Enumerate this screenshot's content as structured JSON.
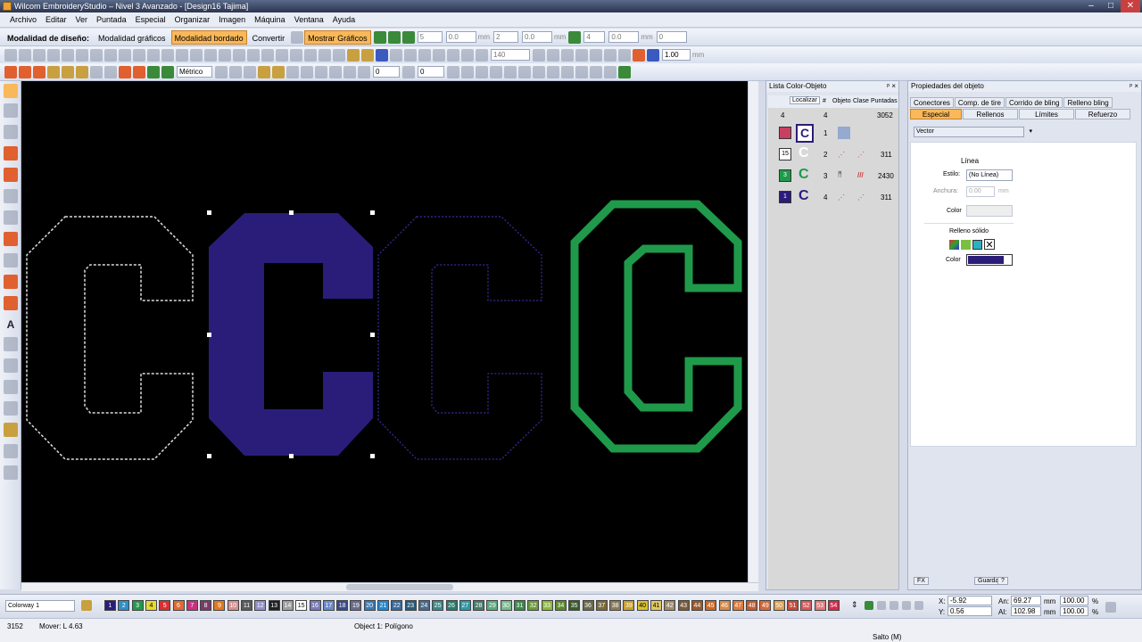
{
  "window": {
    "title": "Wilcom EmbroideryStudio – Nivel 3 Avanzado - [Design16       Tajima]",
    "controls": [
      "–",
      "□",
      "✕"
    ]
  },
  "menu": [
    "Archivo",
    "Editar",
    "Ver",
    "Puntada",
    "Especial",
    "Organizar",
    "Imagen",
    "Máquina",
    "Ventana",
    "Ayuda"
  ],
  "mode_toolbar": {
    "label": "Modalidad de diseño:",
    "graphics_mode": "Modalidad gráficos",
    "embroidery_mode": "Modalidad bordado",
    "convert": "Convertir",
    "show_graphics": "Mostrar Gráficos"
  },
  "transform_toolbar": {
    "fields": [
      "5",
      "0.0",
      "2",
      "0.0",
      "4",
      "0.0",
      "0"
    ],
    "units": [
      "mm",
      "mm",
      "mm",
      "mm"
    ]
  },
  "zoom_toolbar": {
    "zoom": "140",
    "scale": "1.00",
    "scale_unit": "mm"
  },
  "third_toolbar": {
    "units_select": "Métrico",
    "angle_a": "0",
    "angle_b": "0"
  },
  "color_list": {
    "title": "Lista Color-Objeto",
    "locate_button": "Localizar",
    "headers": [
      "#",
      "Objeto",
      "Clase",
      "Puntadas"
    ],
    "summary": {
      "colors": "4",
      "count": "4",
      "stitches": "3052"
    },
    "rows": [
      {
        "color_num": "1",
        "num": "1",
        "stitches": "",
        "swatch": "#c84060"
      },
      {
        "color_num": "15",
        "num": "2",
        "stitches": "311",
        "swatch": "#ffffff"
      },
      {
        "color_num": "3",
        "num": "3",
        "stitches": "2430",
        "swatch": "#1f9a4a"
      },
      {
        "color_num": "1",
        "num": "4",
        "stitches": "311",
        "swatch": "#2a1d7a"
      }
    ]
  },
  "properties": {
    "title": "Propiedades del objeto",
    "tabs_row1": [
      "Conectores",
      "Comp. de tire",
      "Corrido de bling",
      "Relleno bling"
    ],
    "tabs_row2": [
      "Especial",
      "Rellenos",
      "Límites",
      "Refuerzo"
    ],
    "active_tab": "Especial",
    "type_select": "Vector",
    "line_section": "Línea",
    "style_label": "Estilo:",
    "style_value": "(No Línea)",
    "width_label": "Anchura:",
    "width_value": "0.00",
    "width_unit": "mm",
    "line_color_label": "Color",
    "fill_section": "Relleno sólido",
    "fill_color_label": "Color",
    "fill_color": "#2a1d7a",
    "fx_button": "FX",
    "save_button": "Guardar",
    "help_button": "?"
  },
  "colorway": {
    "name": "Colorway 1",
    "swatches": [
      {
        "n": "1",
        "c": "#2a1d7a"
      },
      {
        "n": "2",
        "c": "#2f8fc8"
      },
      {
        "n": "3",
        "c": "#1f9a4a"
      },
      {
        "n": "4",
        "c": "#e8d830"
      },
      {
        "n": "5",
        "c": "#d83030"
      },
      {
        "n": "6",
        "c": "#e06a30"
      },
      {
        "n": "7",
        "c": "#c83080"
      },
      {
        "n": "8",
        "c": "#7a3a6a"
      },
      {
        "n": "9",
        "c": "#e07a20"
      },
      {
        "n": "10",
        "c": "#d89090"
      },
      {
        "n": "11",
        "c": "#5a5a5a"
      },
      {
        "n": "12",
        "c": "#9090c8"
      },
      {
        "n": "13",
        "c": "#202020"
      },
      {
        "n": "14",
        "c": "#a0a0a0"
      },
      {
        "n": "15",
        "c": "#ffffff"
      },
      {
        "n": "16",
        "c": "#7a7ab8"
      },
      {
        "n": "17",
        "c": "#6a8ac8"
      },
      {
        "n": "18",
        "c": "#3a4a8a"
      },
      {
        "n": "19",
        "c": "#6a6a8a"
      },
      {
        "n": "20",
        "c": "#3a7ab8"
      },
      {
        "n": "21",
        "c": "#1a8ad8"
      },
      {
        "n": "22",
        "c": "#3a6a9a"
      },
      {
        "n": "23",
        "c": "#2a5a7a"
      },
      {
        "n": "24",
        "c": "#4a6a8a"
      },
      {
        "n": "25",
        "c": "#3a8a8a"
      },
      {
        "n": "26",
        "c": "#2a7a6a"
      },
      {
        "n": "27",
        "c": "#2a9aaa"
      },
      {
        "n": "28",
        "c": "#4a7a6a"
      },
      {
        "n": "29",
        "c": "#5aaa7a"
      },
      {
        "n": "30",
        "c": "#7aba8a"
      },
      {
        "n": "31",
        "c": "#3a8a4a"
      },
      {
        "n": "32",
        "c": "#6a9a3a"
      },
      {
        "n": "33",
        "c": "#8aba3a"
      },
      {
        "n": "34",
        "c": "#5a8a2a"
      },
      {
        "n": "35",
        "c": "#3a5a2a"
      },
      {
        "n": "36",
        "c": "#6a6a4a"
      },
      {
        "n": "37",
        "c": "#7a6a3a"
      },
      {
        "n": "38",
        "c": "#8a7a5a"
      },
      {
        "n": "39",
        "c": "#c8a030"
      },
      {
        "n": "40",
        "c": "#d8c030"
      },
      {
        "n": "41",
        "c": "#e0c860"
      },
      {
        "n": "42",
        "c": "#a08a6a"
      },
      {
        "n": "43",
        "c": "#7a5a3a"
      },
      {
        "n": "44",
        "c": "#9a5a2a"
      },
      {
        "n": "45",
        "c": "#c86a2a"
      },
      {
        "n": "46",
        "c": "#d88a4a"
      },
      {
        "n": "47",
        "c": "#e07a3a"
      },
      {
        "n": "48",
        "c": "#c85a2a"
      },
      {
        "n": "49",
        "c": "#d86a3a"
      },
      {
        "n": "50",
        "c": "#e0a050"
      },
      {
        "n": "51",
        "c": "#c84a3a"
      },
      {
        "n": "52",
        "c": "#d85a5a"
      },
      {
        "n": "53",
        "c": "#e07a7a"
      },
      {
        "n": "54",
        "c": "#d82a4a"
      }
    ]
  },
  "coords": {
    "x_label": "X:",
    "x": "-5.92",
    "y_label": "Y:",
    "y": "0.56",
    "w_label": "An:",
    "w": "69.27",
    "h_label": "Al:",
    "h": "102.98",
    "unit": "mm",
    "sx": "100.00",
    "sy": "100.00",
    "pct": "%"
  },
  "status": {
    "stitches": "3152",
    "move": "Mover: L 4.63",
    "object": "Object 1: Polígono",
    "jump": "Salto (M)"
  }
}
